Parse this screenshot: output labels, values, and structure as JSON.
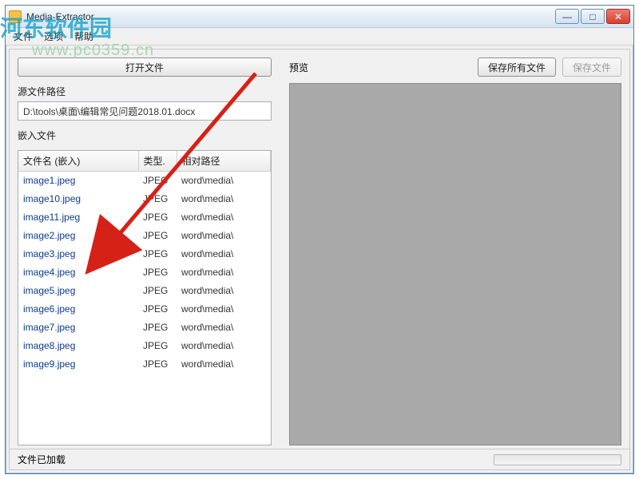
{
  "watermark": {
    "logo": "河东软件园",
    "url": "www.pc0359.cn"
  },
  "window": {
    "title": "Media-Extractor"
  },
  "menu": {
    "file": "文件",
    "options": "选项",
    "help": "帮助"
  },
  "left": {
    "open_btn": "打开文件",
    "source_label": "源文件路径",
    "source_path": "D:\\tools\\桌面\\编辑常见问题2018.01.docx",
    "embed_label": "嵌入文件",
    "cols": {
      "name": "文件名 (嵌入)",
      "type": "类型.",
      "relpath": "相对路径"
    },
    "rows": [
      {
        "name": "image1.jpeg",
        "type": "JPEG",
        "path": "word\\media\\"
      },
      {
        "name": "image10.jpeg",
        "type": "JPEG",
        "path": "word\\media\\"
      },
      {
        "name": "image11.jpeg",
        "type": "JPEG",
        "path": "word\\media\\"
      },
      {
        "name": "image2.jpeg",
        "type": "JPEG",
        "path": "word\\media\\"
      },
      {
        "name": "image3.jpeg",
        "type": "JPEG",
        "path": "word\\media\\"
      },
      {
        "name": "image4.jpeg",
        "type": "JPEG",
        "path": "word\\media\\"
      },
      {
        "name": "image5.jpeg",
        "type": "JPEG",
        "path": "word\\media\\"
      },
      {
        "name": "image6.jpeg",
        "type": "JPEG",
        "path": "word\\media\\"
      },
      {
        "name": "image7.jpeg",
        "type": "JPEG",
        "path": "word\\media\\"
      },
      {
        "name": "image8.jpeg",
        "type": "JPEG",
        "path": "word\\media\\"
      },
      {
        "name": "image9.jpeg",
        "type": "JPEG",
        "path": "word\\media\\"
      }
    ]
  },
  "right": {
    "preview_label": "预览",
    "save_all_btn": "保存所有文件",
    "save_btn": "保存文件"
  },
  "status": {
    "text": "文件已加载"
  }
}
